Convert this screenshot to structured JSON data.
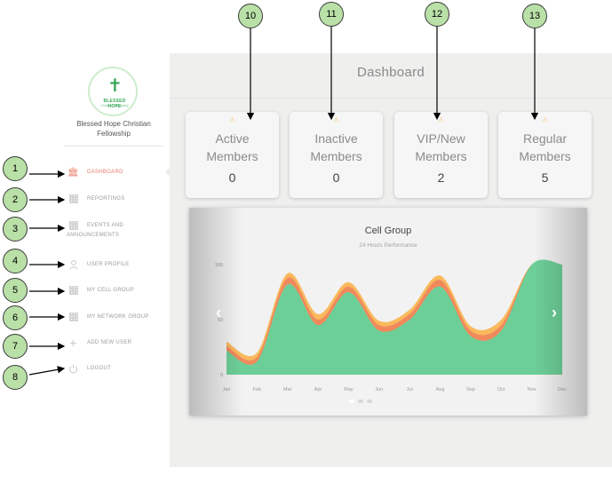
{
  "sidebar": {
    "org_name": "Blessed Hope Christian Fellowship",
    "logo": {
      "name": "BLESSED HOPE",
      "subtitle": "Christian Fellowship",
      "icon": "cross-icon",
      "color": "#3aa75a"
    },
    "items": [
      {
        "label": "DASHBOARD",
        "icon": "bank-icon",
        "active": true
      },
      {
        "label": "REPORTINGS",
        "icon": "grid-icon",
        "active": false
      },
      {
        "label": "EVENTS AND",
        "label2": "ANNOUNCEMENTS",
        "icon": "grid-icon",
        "active": false
      },
      {
        "label": "USER PROFILE",
        "icon": "user-icon",
        "active": false
      },
      {
        "label": "MY CELL GROUP",
        "icon": "grid-icon",
        "active": false
      },
      {
        "label": "MY NETWORK GROUP",
        "icon": "grid-icon",
        "active": false
      },
      {
        "label": "ADD NEW USER",
        "icon": "plus-icon",
        "active": false
      },
      {
        "label": "LOGOUT",
        "icon": "power-icon",
        "active": false
      }
    ],
    "active_color": "#e57f6c"
  },
  "main": {
    "title": "Dashboard",
    "stats": [
      {
        "label_line1": "Active",
        "label_line2": "Members",
        "value": "0",
        "icon": "warning-icon"
      },
      {
        "label_line1": "Inactive",
        "label_line2": "Members",
        "value": "0",
        "icon": "warning-icon"
      },
      {
        "label_line1": "VIP/New",
        "label_line2": "Members",
        "value": "2",
        "icon": "warning-icon"
      },
      {
        "label_line1": "Regular",
        "label_line2": "Members",
        "value": "5",
        "icon": "warning-icon"
      }
    ]
  },
  "chart_data": {
    "type": "area",
    "title": "Cell Group",
    "subtitle": "24 Hours Performance",
    "categories": [
      "Jan",
      "Feb",
      "Mar",
      "Apr",
      "May",
      "Jun",
      "Jul",
      "Aug",
      "Sep",
      "Oct",
      "Nov",
      "Dec"
    ],
    "ylim": [
      0,
      100
    ],
    "ytick_labels": [
      "0",
      "50",
      "100"
    ],
    "series": [
      {
        "values": [
          22,
          12,
          82,
          45,
          75,
          40,
          50,
          80,
          35,
          40,
          100,
          100
        ],
        "color": "#6dcf98"
      },
      {
        "values": [
          26,
          16,
          88,
          50,
          80,
          45,
          55,
          86,
          40,
          45,
          100,
          100
        ],
        "color": "#f08a5d"
      },
      {
        "values": [
          30,
          20,
          92,
          55,
          84,
          49,
          59,
          90,
          44,
          50,
          100,
          100
        ],
        "color": "#f9b95c"
      }
    ],
    "grid": false,
    "legend": "none"
  },
  "callouts": [
    "1",
    "2",
    "3",
    "4",
    "5",
    "6",
    "7",
    "8",
    "10",
    "11",
    "12",
    "13"
  ]
}
